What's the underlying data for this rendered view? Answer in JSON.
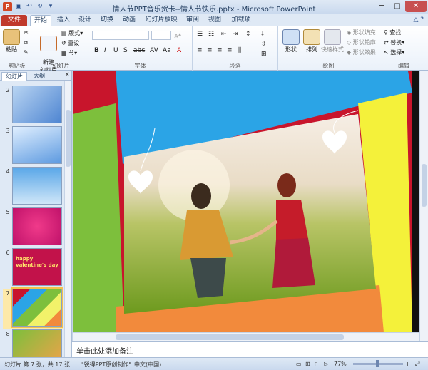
{
  "window": {
    "title": "情人节PPT音乐贺卡--情人节快乐.pptx - Microsoft PowerPoint",
    "app_icon": "P"
  },
  "qat": [
    "save-icon",
    "undo-icon",
    "redo-icon",
    "dropdown-icon"
  ],
  "tabs": [
    "文件",
    "开始",
    "插入",
    "设计",
    "切换",
    "动画",
    "幻灯片放映",
    "审阅",
    "视图",
    "加载项"
  ],
  "ribbon": {
    "clipboard": {
      "label": "剪贴板",
      "paste": "粘贴"
    },
    "slides": {
      "label": "幻灯片",
      "new_slide": "新建\n幻灯片",
      "layout": "版式",
      "reset": "重设",
      "section": "节"
    },
    "font": {
      "label": "字体"
    },
    "paragraph": {
      "label": "段落"
    },
    "drawing": {
      "label": "绘图",
      "shapes": "形状",
      "arrange": "排列",
      "quick_styles": "快速样式",
      "fill": "形状填充",
      "outline": "形状轮廓",
      "effects": "形状效果"
    },
    "editing": {
      "label": "编辑",
      "find": "查找",
      "replace": "替换",
      "select": "选择"
    }
  },
  "panel": {
    "tab_slides": "幻灯片",
    "tab_outline": "大纲",
    "close": "×",
    "thumbs": [
      "2",
      "3",
      "4",
      "5",
      "6",
      "7",
      "8"
    ],
    "thumb6_text": "happy valentine's day"
  },
  "notes": {
    "placeholder": "单击此处添加备注"
  },
  "status": {
    "slide_info": "幻灯片 第 7 张，共 17 张",
    "theme": "\"锐得PPT原创制作\"",
    "language": "中文(中国)",
    "zoom": "77%"
  },
  "colors": {
    "file_tab": "#c0392b",
    "slide_bg": "#c8152c",
    "selected_thumb": "#fde9a9"
  }
}
